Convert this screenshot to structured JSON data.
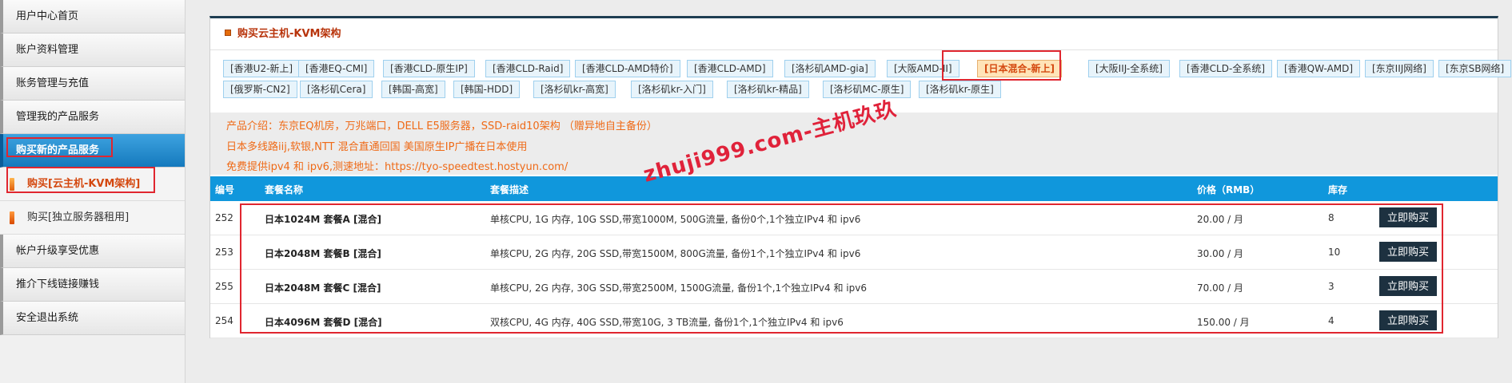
{
  "sidebar": {
    "items": [
      {
        "label": "用户中心首页"
      },
      {
        "label": "账户资料管理"
      },
      {
        "label": "账务管理与充值"
      },
      {
        "label": "管理我的产品服务"
      },
      {
        "label": "购买新的产品服务"
      },
      {
        "label": "购买[云主机-KVM架构]"
      },
      {
        "label": "购买[独立服务器租用]"
      },
      {
        "label": "帐户升级享受优惠"
      },
      {
        "label": "推介下线链接赚钱"
      },
      {
        "label": "安全退出系统"
      }
    ]
  },
  "panel": {
    "title": "购买云主机-KVM架构"
  },
  "tabs": [
    "[香港U2-新上]",
    "[香港EQ-CMI]",
    "[香港CLD-原生IP]",
    "[香港CLD-Raid]",
    "[香港CLD-AMD特价]",
    "[香港CLD-AMD]",
    "[洛杉矶AMD-gia]",
    "[大阪AMD-II]",
    "[日本混合-新上]",
    "[大阪IIJ-全系统]",
    "[香港CLD-全系统]",
    "[香港QW-AMD]",
    "[东京IIJ网络]",
    "[东京SB网络]",
    "[俄罗斯-CN2]",
    "[洛杉矶Cera]",
    "[韩国-高宽]",
    "[韩国-HDD]",
    "[洛杉矶kr-高宽]",
    "[洛杉矶kr-入门]",
    "[洛杉矶kr-精品]",
    "[洛杉矶MC-原生]",
    "[洛杉矶kr-原生]"
  ],
  "active_tab": "[日本混合-新上]",
  "info": {
    "line1": "产品介绍：东京EQ机房，万兆端口，DELL E5服务器，SSD-raid10架构 （赠异地自主备份）",
    "line2": "日本多线路iij,软银,NTT 混合直通回国 美国原生IP广播在日本使用",
    "line3": "免费提供ipv4 和 ipv6,测速地址：https://tyo-speedtest.hostyun.com/"
  },
  "table": {
    "headers": {
      "id": "编号",
      "name": "套餐名称",
      "desc": "套餐描述",
      "price": "价格（RMB）",
      "stock": "库存"
    },
    "rows": [
      {
        "id": "252",
        "name": "日本1024M 套餐A [混合]",
        "desc": "单核CPU, 1G 内存, 10G SSD,带宽1000M, 500G流量, 备份0个,1个独立IPv4 和 ipv6",
        "price": "20.00 / 月",
        "stock": "8",
        "buy": "立即购买"
      },
      {
        "id": "253",
        "name": "日本2048M 套餐B [混合]",
        "desc": "单核CPU, 2G 内存, 20G SSD,带宽1500M, 800G流量, 备份1个,1个独立IPv4 和 ipv6",
        "price": "30.00 / 月",
        "stock": "10",
        "buy": "立即购买"
      },
      {
        "id": "255",
        "name": "日本2048M 套餐C [混合]",
        "desc": "单核CPU, 2G 内存, 30G SSD,带宽2500M, 1500G流量, 备份1个,1个独立IPv4 和 ipv6",
        "price": "70.00 / 月",
        "stock": "3",
        "buy": "立即购买"
      },
      {
        "id": "254",
        "name": "日本4096M 套餐D [混合]",
        "desc": "双核CPU, 4G 内存, 40G SSD,带宽10G, 3 TB流量, 备份1个,1个独立IPv4 和 ipv6",
        "price": "150.00 / 月",
        "stock": "4",
        "buy": "立即购买"
      }
    ]
  },
  "watermark": "zhuji999.com-主机玖玖",
  "colors": {
    "accent": "#1097dc",
    "highlight_red": "#e0262f",
    "info_orange": "#ef6a17",
    "button_dark": "#1d3140"
  }
}
